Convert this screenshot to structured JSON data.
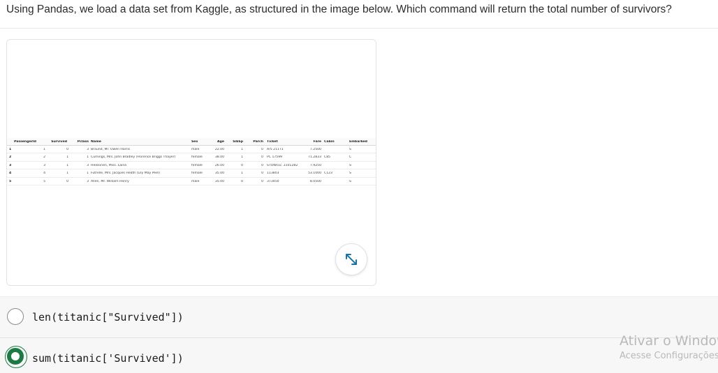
{
  "question": "Using Pandas, we load a data set from Kaggle, as structured in the image below. Which command will return the total number of survivors?",
  "table": {
    "columns": [
      "PassengerId",
      "Survived",
      "Pclass",
      "Name",
      "Sex",
      "Age",
      "SibSp",
      "Parch",
      "Ticket",
      "Fare",
      "Cabin",
      "Embarked"
    ],
    "rows": [
      {
        "idx": "1",
        "PassengerId": "1",
        "Survived": "0",
        "Pclass": "3",
        "Name": "Braund, Mr. Owen Harris",
        "Sex": "male",
        "Age": "22.00",
        "SibSp": "1",
        "Parch": "0",
        "Ticket": "A/5 21171",
        "Fare": "7.2500",
        "Cabin": "",
        "Embarked": "S"
      },
      {
        "idx": "2",
        "PassengerId": "2",
        "Survived": "1",
        "Pclass": "1",
        "Name": "Cumings, Mrs. John Bradley (Florence Briggs Thayer)",
        "Sex": "female",
        "Age": "38.00",
        "SibSp": "1",
        "Parch": "0",
        "Ticket": "PC 17599",
        "Fare": "71.2833",
        "Cabin": "C85",
        "Embarked": "C"
      },
      {
        "idx": "3",
        "PassengerId": "3",
        "Survived": "1",
        "Pclass": "3",
        "Name": "Heikkinen, Miss. Laina",
        "Sex": "female",
        "Age": "26.00",
        "SibSp": "0",
        "Parch": "0",
        "Ticket": "STON/O2. 3101282",
        "Fare": "7.9250",
        "Cabin": "",
        "Embarked": "S"
      },
      {
        "idx": "4",
        "PassengerId": "4",
        "Survived": "1",
        "Pclass": "1",
        "Name": "Futrelle, Mrs. Jacques Heath (Lily May Peel)",
        "Sex": "female",
        "Age": "35.00",
        "SibSp": "1",
        "Parch": "0",
        "Ticket": "113803",
        "Fare": "53.1000",
        "Cabin": "C123",
        "Embarked": "S"
      },
      {
        "idx": "5",
        "PassengerId": "5",
        "Survived": "0",
        "Pclass": "3",
        "Name": "Allen, Mr. William Henry",
        "Sex": "male",
        "Age": "35.00",
        "SibSp": "0",
        "Parch": "0",
        "Ticket": "373450",
        "Fare": "8.0500",
        "Cabin": "",
        "Embarked": "S"
      }
    ]
  },
  "expand_icon": "expand-arrows-icon",
  "options": [
    {
      "label": "len(titanic[\"Survived\"])",
      "selected": false
    },
    {
      "label": "sum(titanic['Survived'])",
      "selected": true
    }
  ],
  "accent_color": "#1d7a45",
  "watermark": {
    "title": "Ativar o Windows",
    "subtitle": "Acesse Configurações"
  }
}
